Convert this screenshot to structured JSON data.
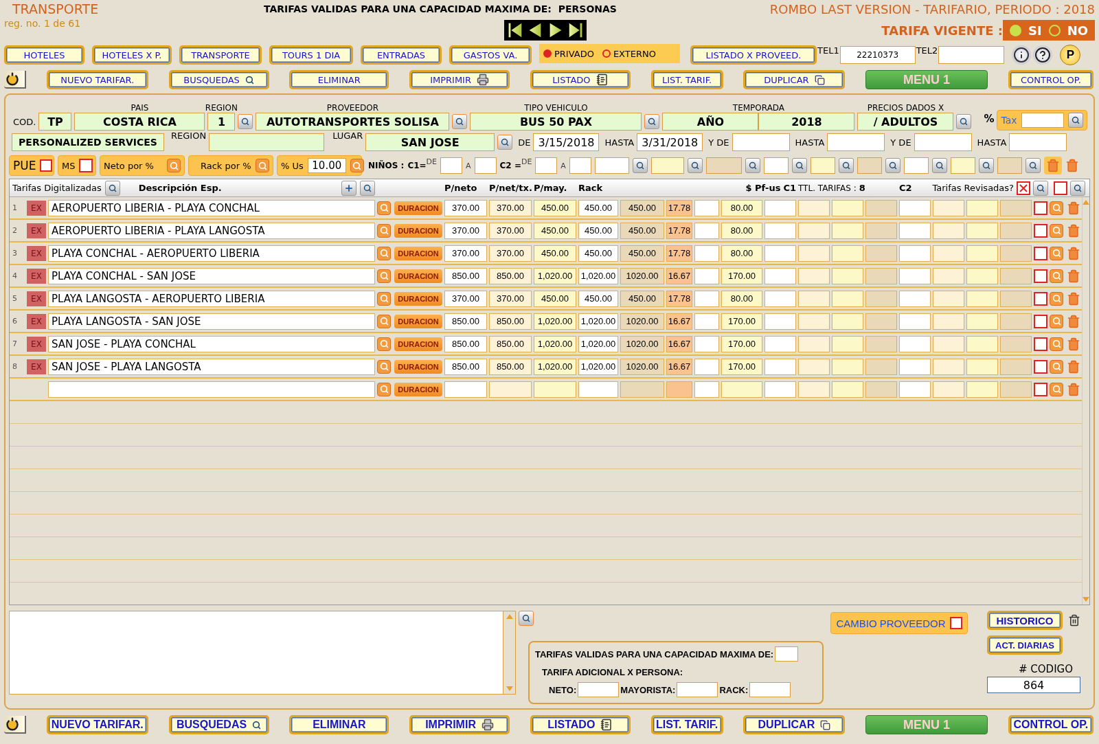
{
  "header": {
    "module": "TRANSPORTE",
    "capacity_title": "TARIFAS VALIDAS PARA UNA CAPACIDAD MAXIMA DE:  PERSONAS",
    "app_title": "ROMBO LAST VERSION - TARIFARIO, PERIODO : 2018",
    "record": "reg. no. 1 de 61"
  },
  "tarifa_vigente": {
    "label": "TARIFA VIGENTE :",
    "options": [
      {
        "label": "SI",
        "selected": true
      },
      {
        "label": "NO",
        "selected": false
      }
    ]
  },
  "modules": [
    "HOTELES",
    "HOTELES X P.",
    "TRANSPORTE",
    "TOURS 1 DIA",
    "ENTRADAS",
    "GASTOS VA."
  ],
  "service_type": [
    {
      "label": "PRIVADO",
      "selected": true
    },
    {
      "label": "EXTERNO",
      "selected": false
    }
  ],
  "listado_proveedor": "LISTADO X PROVEED.",
  "tel1": {
    "label": "TEL1",
    "value": "22210373"
  },
  "tel2": {
    "label": "TEL2"
  },
  "p_button": "P",
  "actions": [
    {
      "label": "NUEVO TARIFAR.",
      "kind": "plain"
    },
    {
      "label": "BUSQUEDAS",
      "kind": "search"
    },
    {
      "label": "ELIMINAR",
      "kind": "plain"
    },
    {
      "label": "IMPRIMIR",
      "kind": "printer"
    },
    {
      "label": "LISTADO",
      "kind": "notebook"
    },
    {
      "label": "LIST. TARIF.",
      "kind": "plain"
    },
    {
      "label": "DUPLICAR",
      "kind": "copy"
    },
    {
      "label": "MENU 1",
      "kind": "green"
    },
    {
      "label": "CONTROL OP.",
      "kind": "plain"
    }
  ],
  "form": {
    "cod": {
      "label": "COD.",
      "value": "TP"
    },
    "pais": {
      "label": "PAIS",
      "value": "COSTA RICA"
    },
    "region": {
      "label": "REGION",
      "value": "1"
    },
    "proveedor": {
      "label": "PROVEEDOR",
      "value": "AUTOTRANSPORTES SOLISA"
    },
    "tipo_vehiculo": {
      "label": "TIPO VEHICULO",
      "value": "BUS 50 PAX"
    },
    "temporada": {
      "label": "TEMPORADA",
      "values": [
        "AÑO",
        "2018"
      ]
    },
    "precios": {
      "label": "PRECIOS DADOS X",
      "value": "/ ADULTOS"
    },
    "percent": "%",
    "tax": {
      "label": "Tax"
    },
    "service_name": "PERSONALIZED SERVICES",
    "region2": {
      "label": "REGION"
    },
    "lugar": {
      "label": "LUGAR",
      "value": "SAN JOSE"
    },
    "dates": [
      {
        "label": "DE",
        "value": "3/15/2018"
      },
      {
        "label": "HASTA",
        "value": "3/31/2018"
      },
      {
        "label": "Y DE"
      },
      {
        "label": "HASTA"
      },
      {
        "label": "Y DE"
      },
      {
        "label": "HASTA"
      }
    ]
  },
  "options_row": {
    "pue": {
      "label": "PUE",
      "checked": false
    },
    "ms": {
      "label": "MS",
      "checked": false
    },
    "neto_pct": "Neto por %",
    "rack_pct": "Rack por %",
    "us_pct": {
      "label": "% Us",
      "value": "10.00"
    },
    "ninos": "NIÑOS :",
    "c1": {
      "label": "C1=",
      "de": "DE",
      "a": "A"
    },
    "c2": {
      "label": "C2 =",
      "de": "DE",
      "a": "A"
    }
  },
  "table": {
    "digitalized_label": "Tarifas Digitalizadas",
    "description_label": "Descripción Esp.",
    "price_columns": [
      "P/neto",
      "P/net/tx.",
      "P/may.",
      "Rack"
    ],
    "pf_us": "$ Pf-us",
    "c1": "C1",
    "total_label": "TTL. TARIFAS :",
    "total": "8",
    "c2": "C2",
    "reviewed": {
      "label": "Tarifas Revisadas?",
      "checked": true
    },
    "reviewed_2": {
      "checked": false
    },
    "rows": [
      {
        "n": "1",
        "tag": "EX",
        "description": "AEROPUERTO LIBERIA - PLAYA CONCHAL",
        "button": "DURACION",
        "p_neto": "370.00",
        "p_net_tx": "370.00",
        "p_may": "450.00",
        "rack": "450.00",
        "column_9": "450.00",
        "column_10": "17.78",
        "pf_us": "80.00",
        "checked": false
      },
      {
        "n": "2",
        "tag": "EX",
        "description": "AEROPUERTO LIBERIA - PLAYA LANGOSTA",
        "button": "DURACION",
        "p_neto": "370.00",
        "p_net_tx": "370.00",
        "p_may": "450.00",
        "rack": "450.00",
        "column_9": "450.00",
        "column_10": "17.78",
        "pf_us": "80.00",
        "checked": false
      },
      {
        "n": "3",
        "tag": "EX",
        "description": "PLAYA CONCHAL - AEROPUERTO LIBERIA",
        "button": "DURACION",
        "p_neto": "370.00",
        "p_net_tx": "370.00",
        "p_may": "450.00",
        "rack": "450.00",
        "column_9": "450.00",
        "column_10": "17.78",
        "pf_us": "80.00",
        "checked": false
      },
      {
        "n": "4",
        "tag": "EX",
        "description": "PLAYA CONCHAL - SAN JOSE",
        "button": "DURACION",
        "p_neto": "850.00",
        "p_net_tx": "850.00",
        "p_may": "1,020.00",
        "rack": "1,020.00",
        "column_9": "1020.00",
        "column_10": "16.67",
        "pf_us": "170.00",
        "checked": false
      },
      {
        "n": "5",
        "tag": "EX",
        "description": "PLAYA LANGOSTA - AEROPUERTO LIBERIA",
        "button": "DURACION",
        "p_neto": "370.00",
        "p_net_tx": "370.00",
        "p_may": "450.00",
        "rack": "450.00",
        "column_9": "450.00",
        "column_10": "17.78",
        "pf_us": "80.00",
        "checked": false
      },
      {
        "n": "6",
        "tag": "EX",
        "description": "PLAYA LANGOSTA - SAN JOSE",
        "button": "DURACION",
        "p_neto": "850.00",
        "p_net_tx": "850.00",
        "p_may": "1,020.00",
        "rack": "1,020.00",
        "column_9": "1020.00",
        "column_10": "16.67",
        "pf_us": "170.00",
        "checked": false
      },
      {
        "n": "7",
        "tag": "EX",
        "description": "SAN JOSE - PLAYA CONCHAL",
        "button": "DURACION",
        "p_neto": "850.00",
        "p_net_tx": "850.00",
        "p_may": "1,020.00",
        "rack": "1,020.00",
        "column_9": "1020.00",
        "column_10": "16.67",
        "pf_us": "170.00",
        "checked": false
      },
      {
        "n": "8",
        "tag": "EX",
        "description": "SAN JOSE - PLAYA LANGOSTA",
        "button": "DURACION",
        "p_neto": "850.00",
        "p_net_tx": "850.00",
        "p_may": "1,020.00",
        "rack": "1,020.00",
        "column_9": "1020.00",
        "column_10": "16.67",
        "pf_us": "170.00",
        "checked": false
      }
    ],
    "new_row": {
      "button": "DURACION",
      "checked": false
    }
  },
  "capacity_box": {
    "title": "TARIFAS VALIDAS PARA UNA CAPACIDAD MAXIMA DE:",
    "subtitle": "TARIFA ADICIONAL X PERSONA:",
    "fields": [
      "NETO:",
      "MAYORISTA:",
      "RACK:"
    ]
  },
  "cambio_proveedor": {
    "label": "CAMBIO PROVEEDOR",
    "checked": false
  },
  "historico": "HISTORICO",
  "act_diarias": "ACT. DIARIAS",
  "codigo": {
    "label": "# CODIGO",
    "value": "864"
  },
  "footer_actions": [
    {
      "label": "NUEVO TARIFAR.",
      "kind": "plain"
    },
    {
      "label": "BUSQUEDAS",
      "kind": "search"
    },
    {
      "label": "ELIMINAR",
      "kind": "plain"
    },
    {
      "label": "IMPRIMIR",
      "kind": "printer"
    },
    {
      "label": "LISTADO",
      "kind": "notebook"
    },
    {
      "label": "LIST. TARIF.",
      "kind": "plain"
    },
    {
      "label": "DUPLICAR",
      "kind": "copy"
    },
    {
      "label": "MENU 1",
      "kind": "green"
    },
    {
      "label": "CONTROL OP.",
      "kind": "plain"
    }
  ]
}
